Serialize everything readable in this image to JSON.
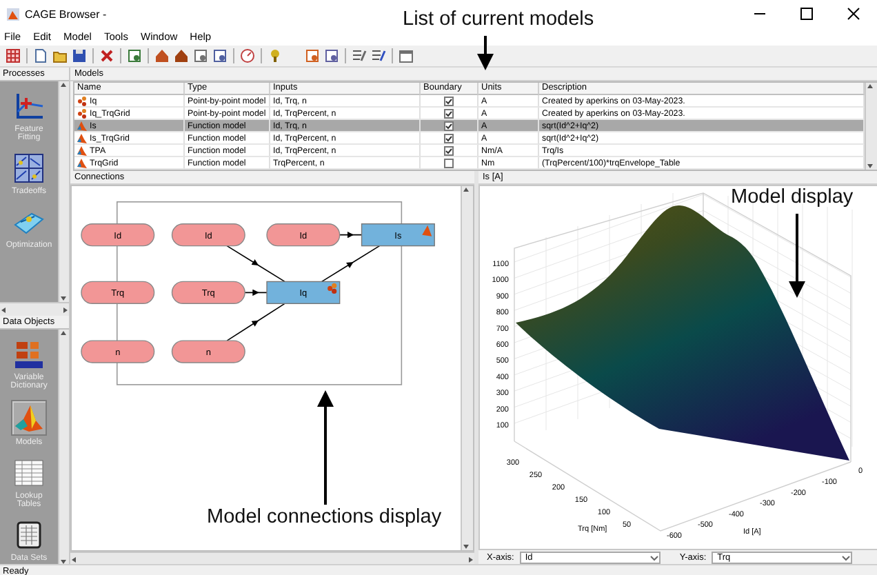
{
  "window": {
    "title": "CAGE Browser -"
  },
  "menu": [
    "File",
    "Edit",
    "Model",
    "Tools",
    "Window",
    "Help"
  ],
  "processes": {
    "title": "Processes",
    "items": [
      {
        "label": "Feature Fitting",
        "kind": "feature",
        "selected": false
      },
      {
        "label": "Tradeoffs",
        "kind": "tradeoff",
        "selected": false
      },
      {
        "label": "Optimization",
        "kind": "optim",
        "selected": false
      }
    ]
  },
  "data_objects": {
    "title": "Data Objects",
    "items": [
      {
        "label": "Variable Dictionary",
        "kind": "vardict",
        "selected": false
      },
      {
        "label": "Models",
        "kind": "models",
        "selected": true
      },
      {
        "label": "Lookup Tables",
        "kind": "tables",
        "selected": false
      },
      {
        "label": "Data Sets",
        "kind": "datasets",
        "selected": false
      }
    ]
  },
  "models": {
    "title": "Models",
    "columns": [
      "Name",
      "Type",
      "Inputs",
      "Boundary",
      "Units",
      "Description"
    ],
    "rows": [
      {
        "kind": "point_by_point",
        "name": "Iq",
        "type": "Point-by-point model",
        "inputs": "Id, Trq, n",
        "boundary": true,
        "units": "A",
        "description": "Created by aperkins on 03-May-2023.",
        "selected": false
      },
      {
        "kind": "point_by_point",
        "name": "Iq_TrqGrid",
        "type": "Point-by-point model",
        "inputs": "Id, TrqPercent, n",
        "boundary": true,
        "units": "A",
        "description": "Created by aperkins on 03-May-2023.",
        "selected": false
      },
      {
        "kind": "function",
        "name": "Is",
        "type": "Function model",
        "inputs": "Id, Trq, n",
        "boundary": true,
        "units": "A",
        "description": "sqrt(Id^2+Iq^2)",
        "selected": true
      },
      {
        "kind": "function",
        "name": "Is_TrqGrid",
        "type": "Function model",
        "inputs": "Id, TrqPercent, n",
        "boundary": true,
        "units": "A",
        "description": "sqrt(Id^2+Iq^2)",
        "selected": false
      },
      {
        "kind": "function",
        "name": "TPA",
        "type": "Function model",
        "inputs": "Id, TrqPercent, n",
        "boundary": true,
        "units": "Nm/A",
        "description": "Trq/Is",
        "selected": false
      },
      {
        "kind": "function",
        "name": "TrqGrid",
        "type": "Function model",
        "inputs": "TrqPercent, n",
        "boundary": false,
        "units": "Nm",
        "description": "(TrqPercent/100)*trqEnvelope_Table",
        "selected": false
      }
    ]
  },
  "connections": {
    "title": "Connections",
    "nodes": [
      {
        "label": "Id",
        "kind": "input"
      },
      {
        "label": "Id",
        "kind": "input"
      },
      {
        "label": "Id",
        "kind": "input"
      },
      {
        "label": "Is",
        "kind": "function_model"
      },
      {
        "label": "Trq",
        "kind": "input"
      },
      {
        "label": "Trq",
        "kind": "input"
      },
      {
        "label": "Iq",
        "kind": "pbp_model"
      },
      {
        "label": "n",
        "kind": "input"
      },
      {
        "label": "n",
        "kind": "input"
      }
    ]
  },
  "display": {
    "title": "Is [A]",
    "z_ticks": [
      "1100",
      "1000",
      "900",
      "800",
      "700",
      "600",
      "500",
      "400",
      "300",
      "200",
      "100"
    ],
    "y_ticks": [
      "300",
      "250",
      "200",
      "150",
      "100",
      "50"
    ],
    "y_label": "Trq [Nm]",
    "x_ticks": [
      "-600",
      "-500",
      "-400",
      "-300",
      "-200",
      "-100",
      "0"
    ],
    "x_label": "Id [A]",
    "x_axis": {
      "label": "X-axis:",
      "value": "Id"
    },
    "y_axis": {
      "label": "Y-axis:",
      "value": "Trq"
    }
  },
  "annotations": [
    "List of current models",
    "Model display",
    "Model connections display"
  ],
  "status_bar": "Ready"
}
